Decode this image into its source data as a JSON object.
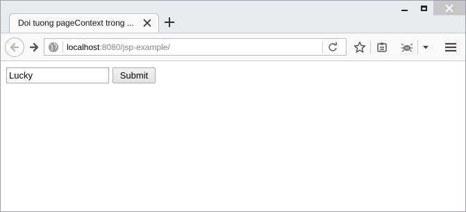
{
  "window": {
    "controls": {
      "minimize": "minimize-icon",
      "maximize": "maximize-icon",
      "close": "close-icon"
    }
  },
  "tabs": [
    {
      "title": "Doi tuong pageContext trong ...",
      "active": true
    }
  ],
  "navbar": {
    "url_host": "localhost",
    "url_rest": ":8080/jsp-example/",
    "icons": [
      "back-icon",
      "forward-icon",
      "globe-icon",
      "reload-icon",
      "bookmark-star-icon",
      "reading-list-icon",
      "firebug-icon",
      "dropdown-icon",
      "menu-icon"
    ]
  },
  "form": {
    "input_value": "Lucky",
    "submit_label": "Submit"
  }
}
